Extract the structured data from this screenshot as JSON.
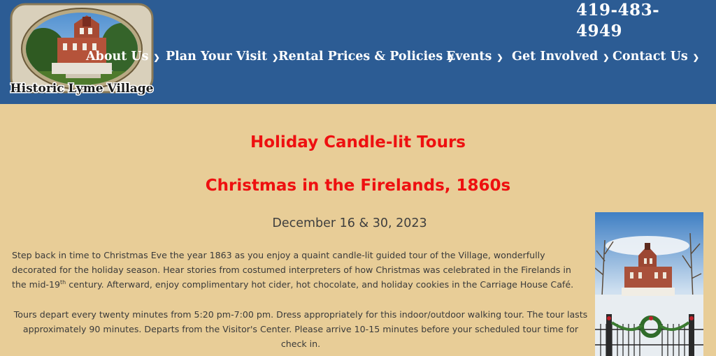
{
  "header": {
    "logo_text": "Historic Lyme Village",
    "phone": "419-483-4949",
    "nav": [
      {
        "label": "About Us"
      },
      {
        "label": "Plan Your Visit"
      },
      {
        "label": "Rental Prices & Policies"
      },
      {
        "label": "Events"
      },
      {
        "label": "Get Involved"
      },
      {
        "label": "Contact Us"
      }
    ]
  },
  "main": {
    "title": "Holiday Candle-lit Tours",
    "subtitle": "Christmas in the Firelands, 1860s",
    "date": "December 16 & 30, 2023",
    "paragraph1_a": "Step back in time to Christmas Eve the year 1863 as you enjoy a quaint candle-lit guided tour of the Village, wonderfully decorated for the holiday season. Hear stories from costumed interpreters of how Christmas was celebrated in the Firelands in the mid-19",
    "paragraph1_sup": "th",
    "paragraph1_b": " century. Afterward, enjoy complimentary hot cider, hot chocolate, and holiday cookies in the Carriage House Café.",
    "paragraph2": "Tours depart every twenty minutes from 5:20 pm-7:00 pm. Dress appropriately for this indoor/outdoor walking tour. The tour lasts approximately 90 minutes. Departs from the Visitor's Center. Please arrive 10-15 minutes before your scheduled tour time for check in."
  },
  "colors": {
    "header_bg": "#2c5c94",
    "page_bg": "#e8cd97",
    "title_red": "#ee1010"
  }
}
